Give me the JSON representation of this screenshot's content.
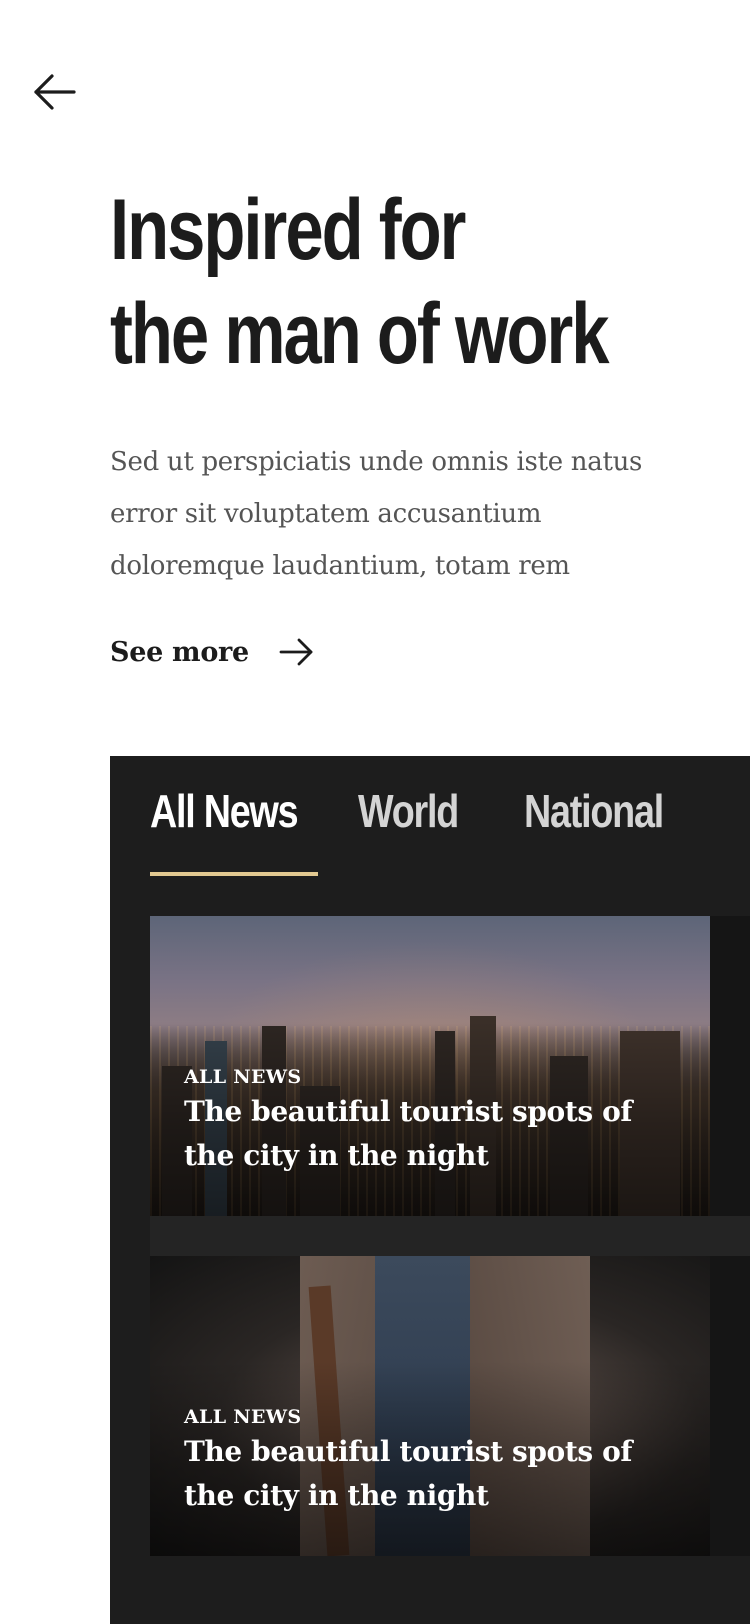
{
  "header": {
    "back_icon": "arrow-left-icon"
  },
  "hero": {
    "title_line1": "Inspired for",
    "title_line2": "the man of work",
    "description": "Sed ut perspiciatis unde omnis iste natus error sit voluptatem accusantium doloremque laudantium, totam rem",
    "see_more_label": "See more",
    "see_more_icon": "arrow-right-icon"
  },
  "news": {
    "tabs": [
      {
        "label": "All News",
        "active": true
      },
      {
        "label": "World",
        "active": false
      },
      {
        "label": "National",
        "active": false
      }
    ],
    "cards": [
      {
        "category": "ALL NEWS",
        "title": "The beautiful tourist spots of the city in the night",
        "image": "city-skyline-night"
      },
      {
        "category": "ALL NEWS",
        "title": "The beautiful tourist spots of the city in the night",
        "image": "man-in-tweed-jacket"
      }
    ]
  },
  "colors": {
    "text_dark": "#1c1c1c",
    "text_body": "#555555",
    "panel_bg": "#1d1d1d",
    "accent_underline": "#e2c991"
  }
}
